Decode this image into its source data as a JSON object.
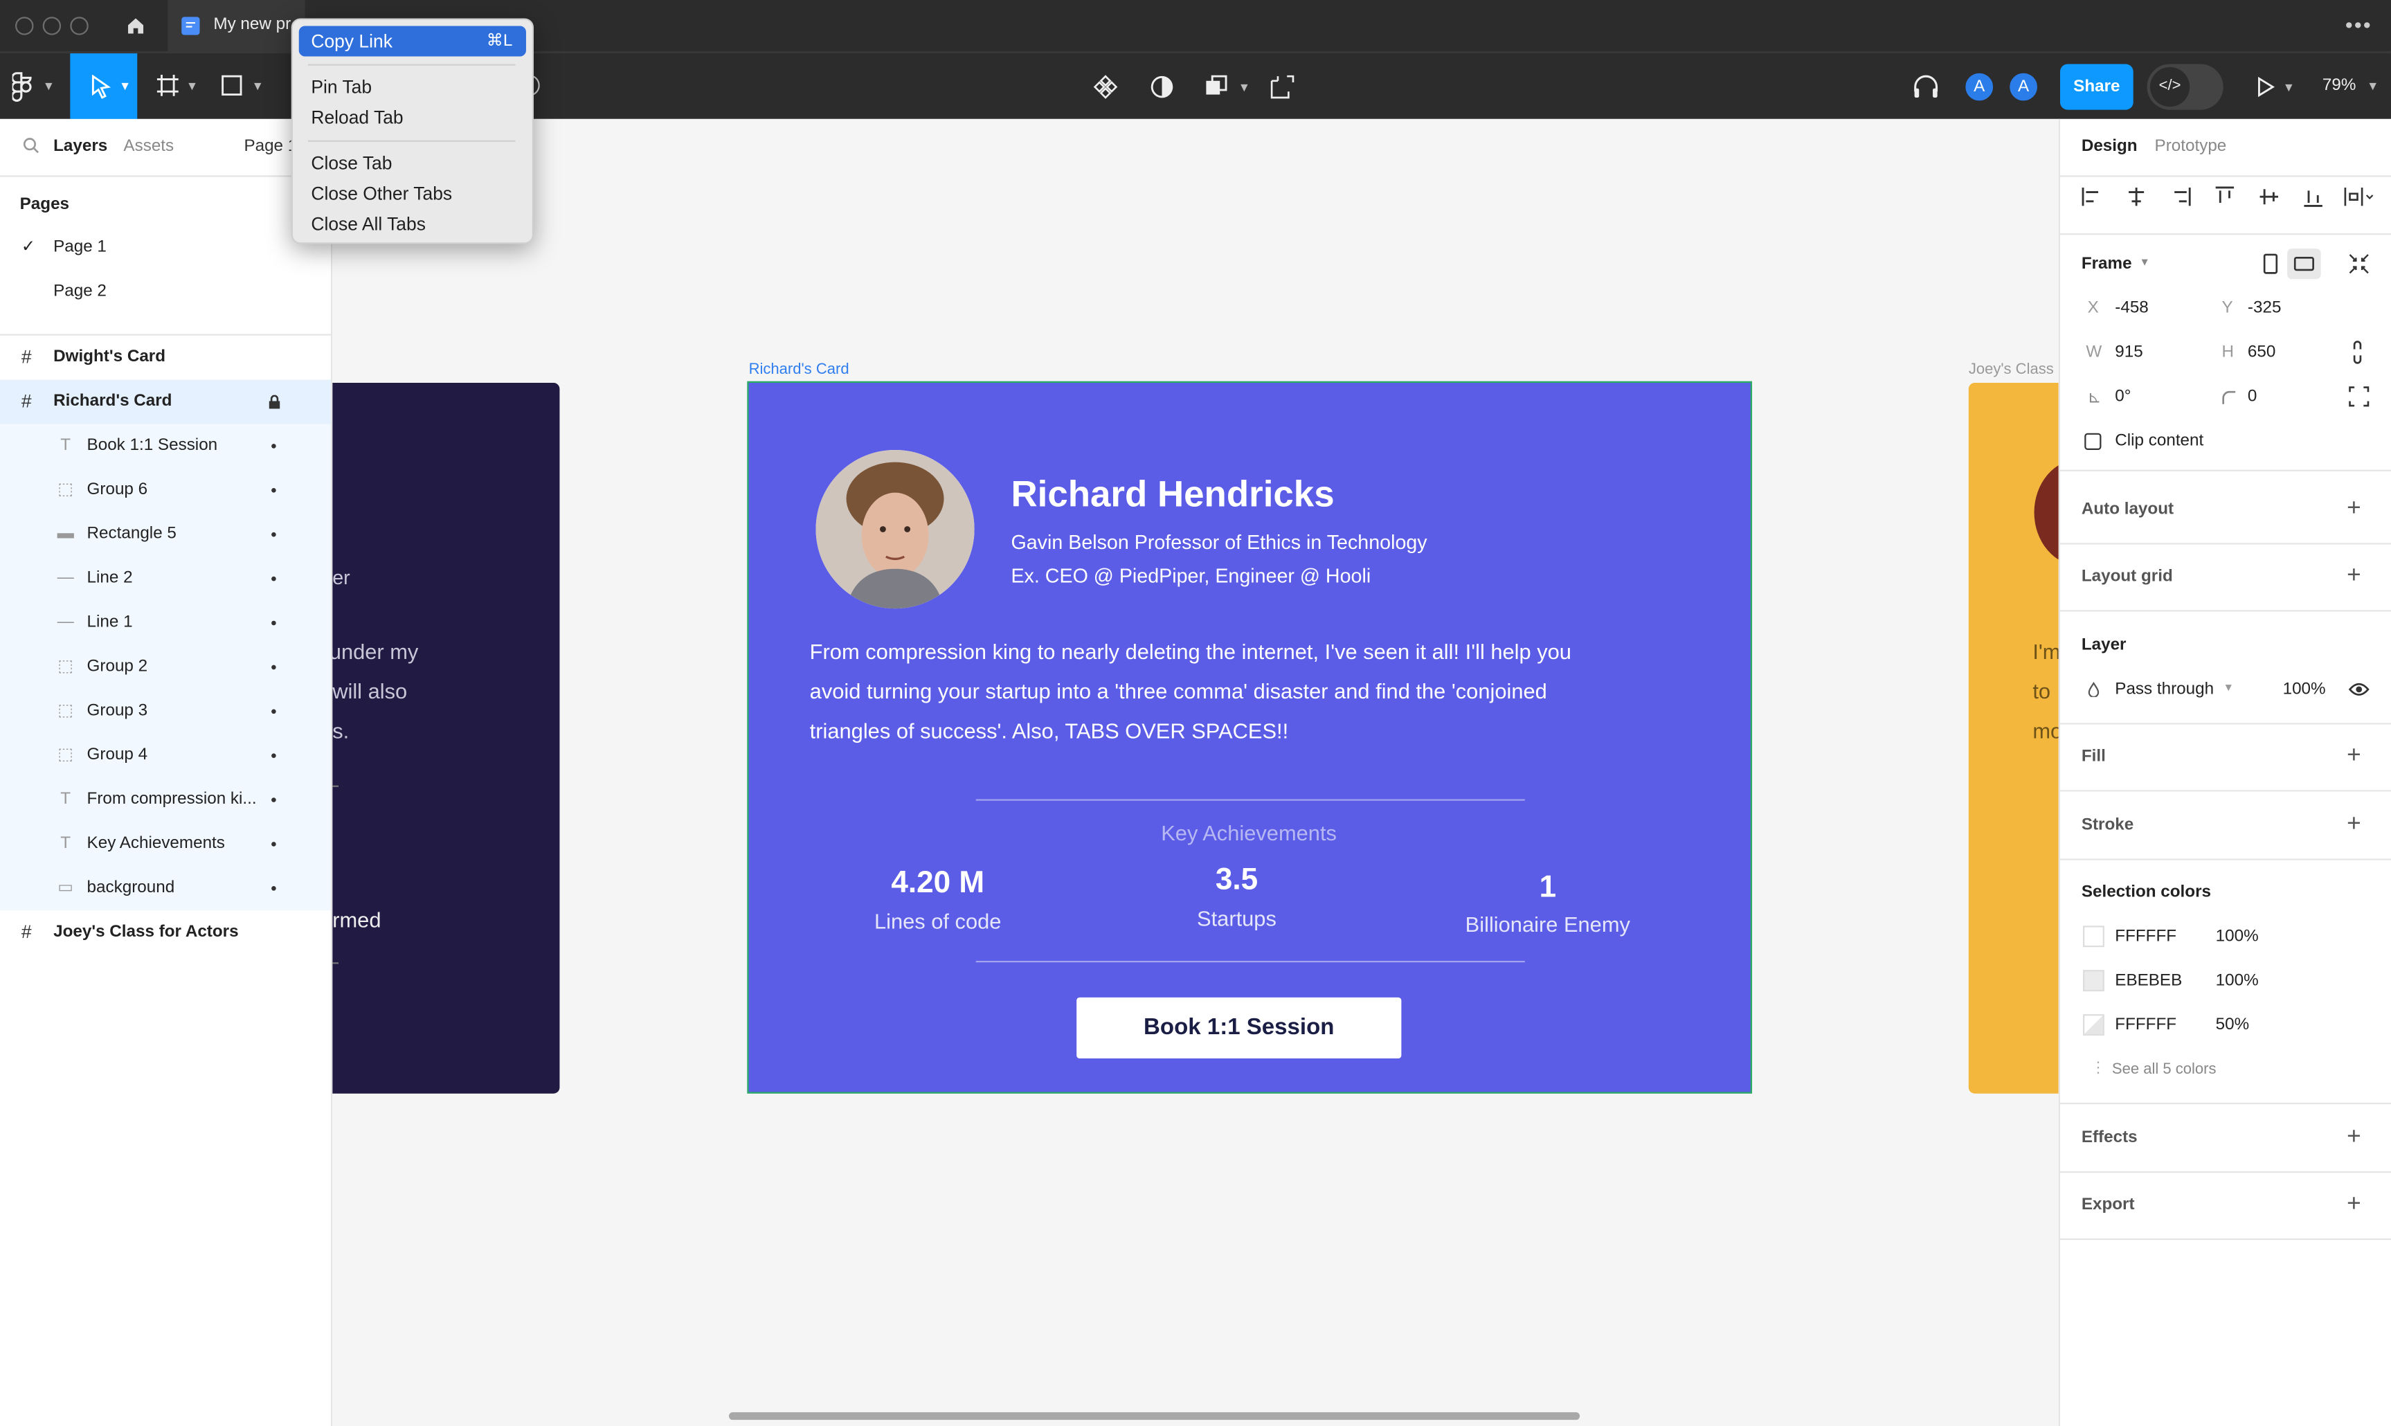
{
  "window": {
    "tab_title": "My new pr"
  },
  "context_menu": {
    "items": [
      {
        "label": "Copy Link",
        "shortcut": "⌘L"
      },
      {
        "label": "Pin Tab"
      },
      {
        "label": "Reload Tab"
      },
      {
        "label": "Close Tab"
      },
      {
        "label": "Close Other Tabs"
      },
      {
        "label": "Close All Tabs"
      }
    ]
  },
  "toolbar": {
    "share_label": "Share",
    "zoom": "79%",
    "avatars": [
      "A",
      "A"
    ]
  },
  "left_panel": {
    "tabs": {
      "layers": "Layers",
      "assets": "Assets",
      "page": "Page 1"
    },
    "pages_heading": "Pages",
    "pages": [
      "Page 1",
      "Page 2"
    ],
    "frames": [
      {
        "name": "Dwight's Card"
      },
      {
        "name": "Richard's Card"
      },
      {
        "name": "Joey's Class for Actors"
      }
    ],
    "layers": [
      {
        "name": "Book 1:1 Session",
        "icon": "text-icon"
      },
      {
        "name": "Group 6",
        "icon": "group-icon"
      },
      {
        "name": "Rectangle 5",
        "icon": "rectangle-icon"
      },
      {
        "name": "Line 2",
        "icon": "line-icon"
      },
      {
        "name": "Line 1",
        "icon": "line-icon"
      },
      {
        "name": "Group 2",
        "icon": "group-icon"
      },
      {
        "name": "Group 3",
        "icon": "group-icon"
      },
      {
        "name": "Group 4",
        "icon": "group-icon"
      },
      {
        "name": "From compression ki...",
        "icon": "text-icon"
      },
      {
        "name": "Key Achievements",
        "icon": "text-icon"
      },
      {
        "name": "background",
        "icon": "rectangle-icon"
      }
    ]
  },
  "canvas": {
    "left_card_fragments": [
      "er",
      "under my",
      "will also",
      "s.",
      "rmed"
    ],
    "right_frame_label": "Joey's Class",
    "right_card_fragments": [
      "I'm",
      "to",
      "mo"
    ],
    "card": {
      "frame_label": "Richard's Card",
      "name": "Richard Hendricks",
      "title_line1": "Gavin Belson Professor of Ethics in Technology",
      "title_line2": "Ex. CEO @ PiedPiper, Engineer @ Hooli",
      "bio_line1": "From compression king to nearly deleting the internet, I've seen it all! I'll help you",
      "bio_line2": "avoid turning your startup into a 'three comma' disaster and find the 'conjoined",
      "bio_line3": "triangles of success'. Also, TABS OVER SPACES!!",
      "achievements_heading": "Key Achievements",
      "stats": [
        {
          "value": "4.20 M",
          "label": "Lines of code"
        },
        {
          "value": "3.5",
          "label": "Startups"
        },
        {
          "value": "1",
          "label": "Billionaire Enemy"
        }
      ],
      "cta": "Book 1:1 Session"
    }
  },
  "right_panel": {
    "tabs": {
      "design": "Design",
      "prototype": "Prototype"
    },
    "frame_label": "Frame",
    "props": {
      "x_label": "X",
      "x": "-458",
      "y_label": "Y",
      "y": "-325",
      "w_label": "W",
      "w": "915",
      "h_label": "H",
      "h": "650",
      "rotation": "0°",
      "radius": "0"
    },
    "clip_content": "Clip content",
    "auto_layout": "Auto layout",
    "layout_grid": "Layout grid",
    "layer_heading": "Layer",
    "blend": "Pass through",
    "opacity": "100%",
    "fill": "Fill",
    "stroke": "Stroke",
    "selection_colors_heading": "Selection colors",
    "selection_colors": [
      {
        "hex": "FFFFFF",
        "opacity": "100%"
      },
      {
        "hex": "EBEBEB",
        "opacity": "100%"
      },
      {
        "hex": "FFFFFF",
        "opacity": "50%"
      }
    ],
    "see_all": "See all 5 colors",
    "effects": "Effects",
    "export": "Export"
  },
  "help": "?"
}
